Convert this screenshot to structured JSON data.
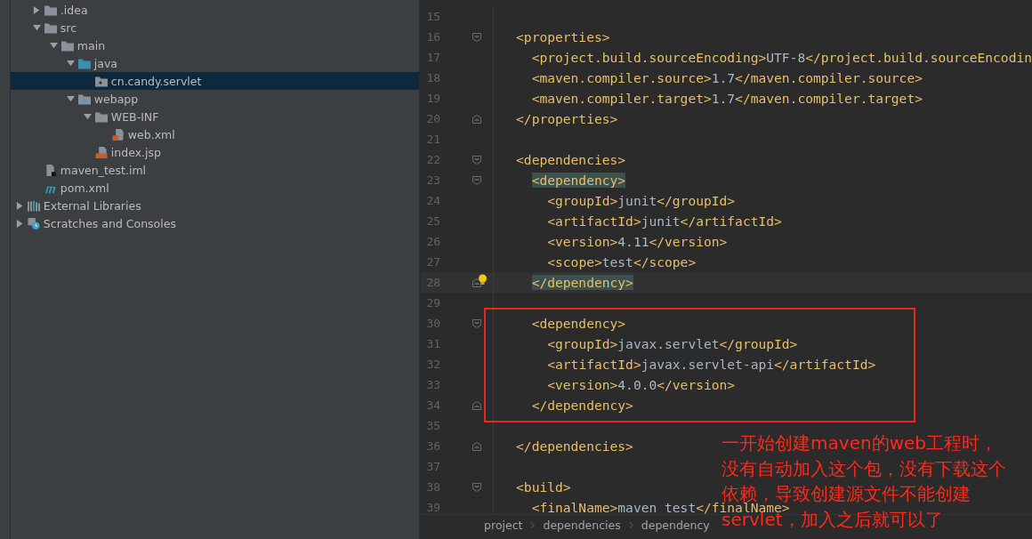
{
  "project_tree": {
    "items": [
      {
        "label": ".idea",
        "kind": "folder",
        "expanded": false,
        "selected": false
      },
      {
        "label": "src",
        "kind": "folder",
        "expanded": true,
        "selected": false,
        "children": [
          {
            "label": "main",
            "kind": "folder",
            "expanded": true,
            "selected": false,
            "children": [
              {
                "label": "java",
                "kind": "sourcefolder",
                "expanded": true,
                "selected": false,
                "children": [
                  {
                    "label": "cn.candy.servlet",
                    "kind": "package",
                    "selected": true
                  }
                ]
              },
              {
                "label": "webapp",
                "kind": "webfolder",
                "expanded": true,
                "selected": false,
                "children": [
                  {
                    "label": "WEB-INF",
                    "kind": "folder",
                    "expanded": true,
                    "selected": false,
                    "children": [
                      {
                        "label": "web.xml",
                        "kind": "xml",
                        "selected": false
                      }
                    ]
                  },
                  {
                    "label": "index.jsp",
                    "kind": "jsp",
                    "selected": false
                  }
                ]
              }
            ]
          }
        ]
      },
      {
        "label": "maven_test.iml",
        "kind": "module",
        "selected": false
      },
      {
        "label": "pom.xml",
        "kind": "maven",
        "selected": false
      }
    ],
    "roots": [
      {
        "label": "External Libraries",
        "kind": "libraries",
        "expanded": false,
        "selected": false
      },
      {
        "label": "Scratches and Consoles",
        "kind": "scratches",
        "expanded": false,
        "selected": false
      }
    ]
  },
  "editor": {
    "lines": [
      {
        "number": "15"
      },
      {
        "number": "16",
        "text": "<properties>",
        "fold_start": true
      },
      {
        "number": "17",
        "text": "  <project.build.sourceEncoding>UTF-8</project.build.sourceEncodin"
      },
      {
        "number": "18",
        "text": "  <maven.compiler.source>1.7</maven.compiler.source>"
      },
      {
        "number": "19",
        "text": "  <maven.compiler.target>1.7</maven.compiler.target>"
      },
      {
        "number": "20",
        "text": "</properties>",
        "fold_end": true
      },
      {
        "number": "21"
      },
      {
        "number": "22",
        "text": "<dependencies>",
        "fold_start": true
      },
      {
        "number": "23",
        "text": "  <dependency>",
        "fold_start": true,
        "highlighted": true
      },
      {
        "number": "24",
        "text": "    <groupId>junit</groupId>"
      },
      {
        "number": "25",
        "text": "    <artifactId>junit</artifactId>"
      },
      {
        "number": "26",
        "text": "    <version>4.11</version>"
      },
      {
        "number": "27",
        "text": "    <scope>test</scope>"
      },
      {
        "number": "28",
        "text": "  </dependency>",
        "fold_end": true,
        "highlighted": true,
        "current": true,
        "bulb": true
      },
      {
        "number": "29"
      },
      {
        "number": "30",
        "text": "  <dependency>",
        "fold_start": true
      },
      {
        "number": "31",
        "text": "    <groupId>javax.servlet</groupId>"
      },
      {
        "number": "32",
        "text": "    <artifactId>javax.servlet-api</artifactId>"
      },
      {
        "number": "33",
        "text": "    <version>4.0.0</version>"
      },
      {
        "number": "34",
        "text": "  </dependency>",
        "fold_end": true
      },
      {
        "number": "35"
      },
      {
        "number": "36",
        "text": "</dependencies>",
        "fold_end": true
      },
      {
        "number": "37"
      },
      {
        "number": "38",
        "text": "<build>",
        "fold_start": true
      },
      {
        "number": "39",
        "text": "  <finalName>maven test</finalName>"
      }
    ],
    "annotation": {
      "lines": [
        "一开始创建maven的web工程时，",
        "没有自动加入这个包，没有下载这个",
        "依赖，导致创建源文件不能创建",
        "servlet，加入之后就可以了"
      ]
    },
    "breadcrumbs": [
      "project",
      "dependencies",
      "dependency"
    ]
  }
}
